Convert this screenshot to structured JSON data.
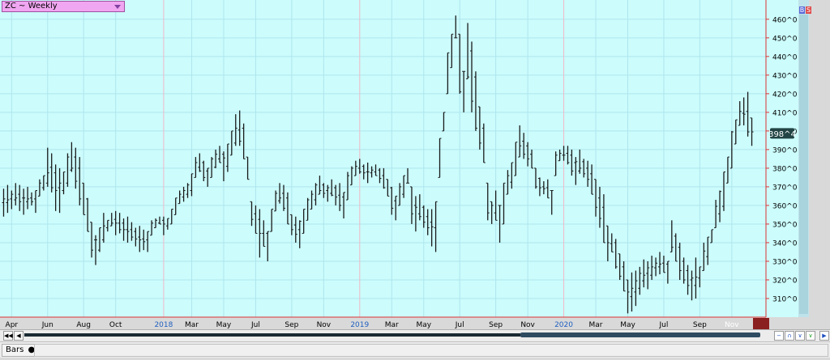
{
  "header": {
    "title": "ZC ~ Weekly"
  },
  "side_buttons": {
    "b": "B",
    "s": "S"
  },
  "status": {
    "tab_label": "Bars"
  },
  "chart_data": {
    "type": "ohlc-bar",
    "ylim": [
      300,
      466
    ],
    "ytick_values": [
      310,
      320,
      330,
      340,
      350,
      360,
      370,
      380,
      390,
      400,
      410,
      420,
      430,
      440,
      450,
      460
    ],
    "ytick_labels": [
      "310^0",
      "320^0",
      "330^0",
      "340^0",
      "350^0",
      "360^0",
      "370^0",
      "380^0",
      "390^0",
      "400^0",
      "410^0",
      "420^0",
      "430^0",
      "440^0",
      "450^0",
      "460^0"
    ],
    "last_price_label": "398^4",
    "last_price": 398.5,
    "x_labels": [
      {
        "text": "Apr",
        "index": 2,
        "year": false
      },
      {
        "text": "Jun",
        "index": 11,
        "year": false
      },
      {
        "text": "Aug",
        "index": 20,
        "year": false
      },
      {
        "text": "Oct",
        "index": 28,
        "year": false
      },
      {
        "text": "2018",
        "index": 40,
        "year": true
      },
      {
        "text": "Mar",
        "index": 47,
        "year": false
      },
      {
        "text": "May",
        "index": 55,
        "year": false
      },
      {
        "text": "Jul",
        "index": 63,
        "year": false
      },
      {
        "text": "Sep",
        "index": 72,
        "year": false
      },
      {
        "text": "Nov",
        "index": 80,
        "year": false
      },
      {
        "text": "2019",
        "index": 89,
        "year": true
      },
      {
        "text": "Mar",
        "index": 97,
        "year": false
      },
      {
        "text": "May",
        "index": 105,
        "year": false
      },
      {
        "text": "Jul",
        "index": 114,
        "year": false
      },
      {
        "text": "Sep",
        "index": 123,
        "year": false
      },
      {
        "text": "Nov",
        "index": 131,
        "year": false
      },
      {
        "text": "2020",
        "index": 140,
        "year": true
      },
      {
        "text": "Mar",
        "index": 148,
        "year": false
      },
      {
        "text": "May",
        "index": 156,
        "year": false
      },
      {
        "text": "Jul",
        "index": 165,
        "year": false
      },
      {
        "text": "Sep",
        "index": 174,
        "year": false
      },
      {
        "text": "Nov",
        "index": 182,
        "year": false
      }
    ],
    "bars": [
      [
        354,
        369
      ],
      [
        356,
        371
      ],
      [
        358,
        368
      ],
      [
        360,
        372
      ],
      [
        357,
        371
      ],
      [
        355,
        369
      ],
      [
        358,
        370
      ],
      [
        360,
        367
      ],
      [
        356,
        368
      ],
      [
        365,
        374
      ],
      [
        368,
        376
      ],
      [
        370,
        391
      ],
      [
        367,
        388
      ],
      [
        357,
        382
      ],
      [
        356,
        380
      ],
      [
        366,
        378
      ],
      [
        370,
        388
      ],
      [
        378,
        394
      ],
      [
        369,
        391
      ],
      [
        360,
        386
      ],
      [
        355,
        372
      ],
      [
        346,
        364
      ],
      [
        332,
        351
      ],
      [
        328,
        344
      ],
      [
        335,
        348
      ],
      [
        340,
        356
      ],
      [
        346,
        352
      ],
      [
        349,
        356
      ],
      [
        344,
        357
      ],
      [
        345,
        356
      ],
      [
        341,
        353
      ],
      [
        340,
        354
      ],
      [
        341,
        351
      ],
      [
        338,
        348
      ],
      [
        335,
        349
      ],
      [
        336,
        347
      ],
      [
        335,
        346
      ],
      [
        344,
        352
      ],
      [
        348,
        353
      ],
      [
        350,
        354
      ],
      [
        344,
        354
      ],
      [
        347,
        353
      ],
      [
        350,
        358
      ],
      [
        355,
        364
      ],
      [
        361,
        368
      ],
      [
        362,
        370
      ],
      [
        364,
        372
      ],
      [
        365,
        377
      ],
      [
        375,
        386
      ],
      [
        378,
        388
      ],
      [
        373,
        384
      ],
      [
        370,
        380
      ],
      [
        375,
        386
      ],
      [
        380,
        390
      ],
      [
        383,
        392
      ],
      [
        373,
        389
      ],
      [
        378,
        393
      ],
      [
        387,
        400
      ],
      [
        392,
        409
      ],
      [
        392,
        411
      ],
      [
        385,
        404
      ],
      [
        374,
        386
      ],
      [
        349,
        362
      ],
      [
        345,
        360
      ],
      [
        332,
        358
      ],
      [
        338,
        352
      ],
      [
        330,
        346
      ],
      [
        346,
        358
      ],
      [
        357,
        368
      ],
      [
        361,
        372
      ],
      [
        357,
        371
      ],
      [
        350,
        367
      ],
      [
        344,
        355
      ],
      [
        340,
        354
      ],
      [
        337,
        352
      ],
      [
        345,
        358
      ],
      [
        352,
        364
      ],
      [
        358,
        368
      ],
      [
        360,
        372
      ],
      [
        366,
        376
      ],
      [
        364,
        372
      ],
      [
        362,
        371
      ],
      [
        365,
        374
      ],
      [
        360,
        371
      ],
      [
        357,
        372
      ],
      [
        353,
        367
      ],
      [
        363,
        378
      ],
      [
        371,
        381
      ],
      [
        376,
        384
      ],
      [
        377,
        385
      ],
      [
        374,
        382
      ],
      [
        372,
        383
      ],
      [
        375,
        381
      ],
      [
        376,
        382
      ],
      [
        372,
        380
      ],
      [
        369,
        380
      ],
      [
        365,
        374
      ],
      [
        355,
        370
      ],
      [
        352,
        365
      ],
      [
        360,
        372
      ],
      [
        364,
        376
      ],
      [
        372,
        380
      ],
      [
        350,
        370
      ],
      [
        346,
        365
      ],
      [
        352,
        366
      ],
      [
        348,
        360
      ],
      [
        344,
        358
      ],
      [
        338,
        358
      ],
      [
        335,
        362
      ],
      [
        375,
        396
      ],
      [
        400,
        410
      ],
      [
        420,
        442
      ],
      [
        434,
        452
      ],
      [
        450,
        462
      ],
      [
        420,
        452
      ],
      [
        410,
        432
      ],
      [
        428,
        458
      ],
      [
        410,
        448
      ],
      [
        400,
        432
      ],
      [
        390,
        413
      ],
      [
        383,
        404
      ],
      [
        352,
        372
      ],
      [
        350,
        362
      ],
      [
        352,
        368
      ],
      [
        340,
        360
      ],
      [
        350,
        372
      ],
      [
        366,
        379
      ],
      [
        369,
        383
      ],
      [
        376,
        394
      ],
      [
        386,
        403
      ],
      [
        385,
        399
      ],
      [
        381,
        394
      ],
      [
        380,
        390
      ],
      [
        369,
        380
      ],
      [
        365,
        375
      ],
      [
        366,
        373
      ],
      [
        364,
        374
      ],
      [
        355,
        368
      ],
      [
        376,
        389
      ],
      [
        384,
        390
      ],
      [
        384,
        392
      ],
      [
        382,
        392
      ],
      [
        376,
        390
      ],
      [
        371,
        386
      ],
      [
        377,
        390
      ],
      [
        375,
        385
      ],
      [
        370,
        384
      ],
      [
        366,
        382
      ],
      [
        354,
        374
      ],
      [
        348,
        370
      ],
      [
        340,
        366
      ],
      [
        330,
        349
      ],
      [
        335,
        345
      ],
      [
        326,
        342
      ],
      [
        320,
        334
      ],
      [
        314,
        330
      ],
      [
        302,
        320
      ],
      [
        303,
        324
      ],
      [
        306,
        325
      ],
      [
        312,
        327
      ],
      [
        316,
        331
      ],
      [
        315,
        330
      ],
      [
        320,
        333
      ],
      [
        322,
        332
      ],
      [
        323,
        335
      ],
      [
        324,
        333
      ],
      [
        318,
        330
      ],
      [
        335,
        352
      ],
      [
        330,
        345
      ],
      [
        320,
        340
      ],
      [
        318,
        332
      ],
      [
        312,
        328
      ],
      [
        309,
        325
      ],
      [
        310,
        332
      ],
      [
        316,
        327
      ],
      [
        325,
        340
      ],
      [
        328,
        343
      ],
      [
        340,
        347
      ],
      [
        348,
        363
      ],
      [
        351,
        368
      ],
      [
        357,
        378
      ],
      [
        372,
        386
      ],
      [
        380,
        400
      ],
      [
        393,
        406
      ],
      [
        403,
        416
      ],
      [
        403,
        418
      ],
      [
        397,
        421
      ],
      [
        392,
        407
      ]
    ],
    "grid": true,
    "background": "#ccfcfc",
    "grid_color": "#aee6ee",
    "bar_color": "#1a1a1a",
    "axis_color": "#dd3333",
    "label_color": "#000000",
    "year_label_color": "#2060c0",
    "price_tag_color": "#224444"
  }
}
